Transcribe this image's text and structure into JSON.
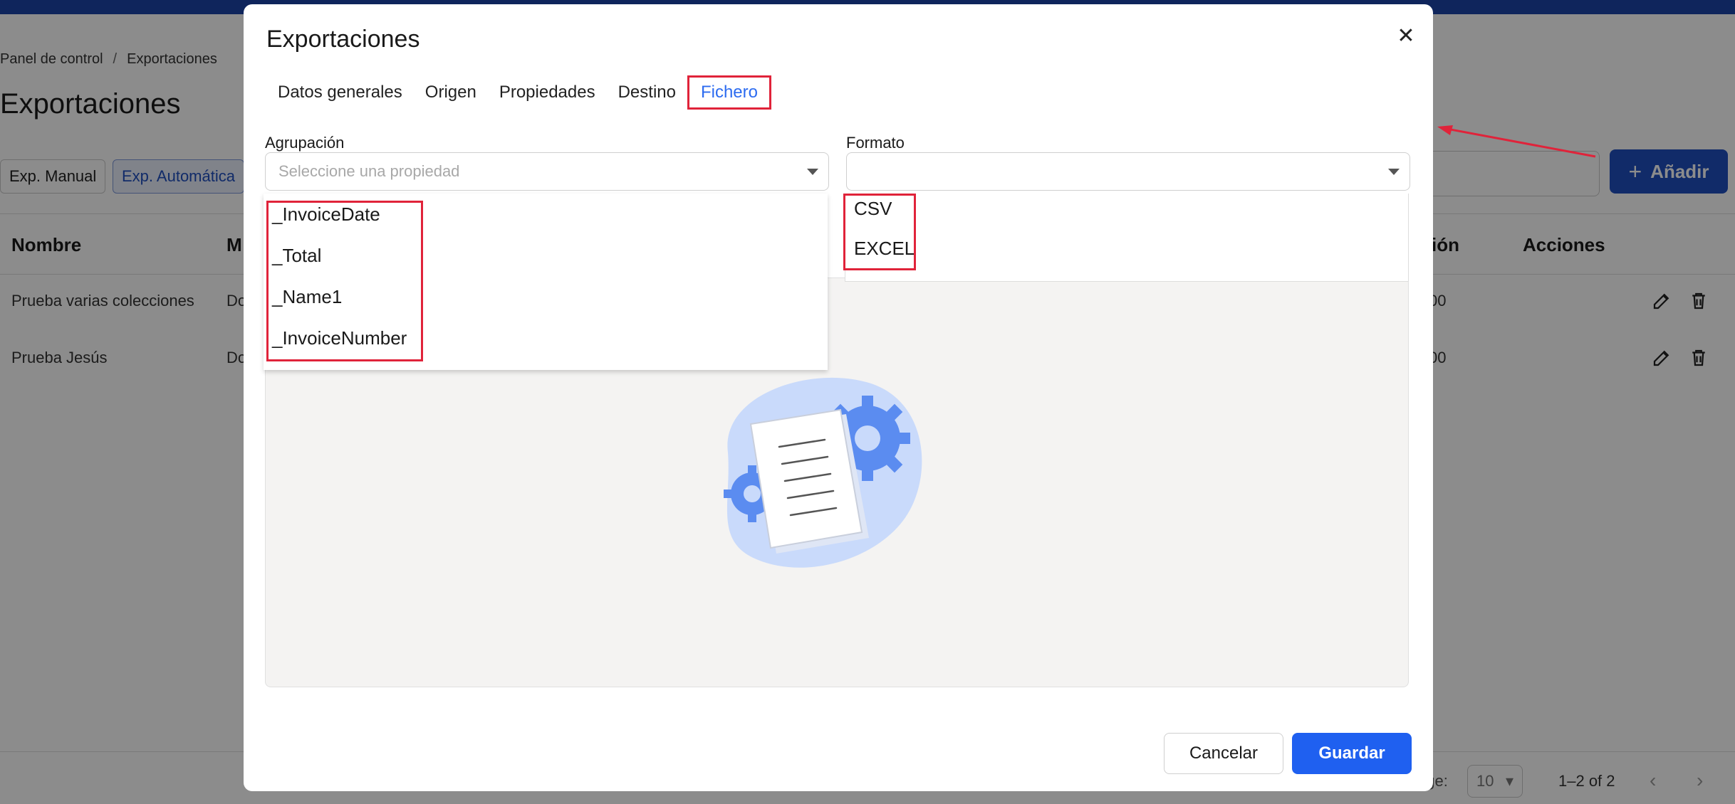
{
  "background": {
    "breadcrumb": [
      "Panel de control",
      "Exportaciones"
    ],
    "breadcrumb_sep": "/",
    "title": "Exportaciones",
    "filters": [
      "Exp. Manual",
      "Exp. Automática"
    ],
    "add_button": "Añadir",
    "table": {
      "headers": [
        "Nombre",
        "M",
        "ión",
        "Acciones"
      ],
      "rows": [
        {
          "name": "Prueba varias colecciones",
          "col2": "Do",
          "col3": "00"
        },
        {
          "name": "Prueba Jesús",
          "col2": "Do",
          "col3": "00"
        }
      ]
    },
    "pagination": {
      "rows_label": "age:",
      "rows_per_page": "10",
      "range": "1–2 of 2"
    }
  },
  "modal": {
    "title": "Exportaciones",
    "close_icon": "close-icon",
    "tabs": [
      "Datos generales",
      "Origen",
      "Propiedades",
      "Destino",
      "Fichero"
    ],
    "active_tab": "Fichero",
    "grouping": {
      "label": "Agrupación",
      "placeholder": "Seleccione una propiedad",
      "options": [
        "_InvoiceDate",
        "_Total",
        "_Name1",
        "_InvoiceNumber"
      ]
    },
    "format": {
      "label": "Formato",
      "value": "",
      "options": [
        "CSV",
        "EXCEL"
      ]
    },
    "cancel_label": "Cancelar",
    "save_label": "Guardar"
  },
  "colors": {
    "accent": "#1f60f0",
    "header": "#1c44a8",
    "highlight": "#e0233a",
    "illustration": "#5b8cf0"
  }
}
